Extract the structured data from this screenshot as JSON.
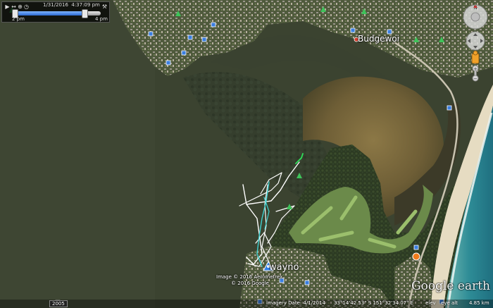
{
  "time_slider": {
    "date": "1/31/2016",
    "time": "4:37:09 pm",
    "start_label": "2 pm",
    "end_label": "4 pm",
    "position": 0.82
  },
  "places": {
    "budgewoi": "Budgewoi",
    "wayno": "wayno"
  },
  "credits": {
    "line1": "Image © 2016 Aerometrex",
    "line2": "© 2016 Google"
  },
  "status_bar": {
    "year": "2005",
    "imagery_date": "Imagery Date: 4/1/2014",
    "coordinates": "33°14'42.53\" S  151°32'34.07\" E",
    "elev_label": "elev",
    "eye_alt_label": "eye alt",
    "eye_alt_value": "4.85 km"
  },
  "logo": {
    "text": "Google earth"
  },
  "colors": {
    "lake_water": "#3d4531",
    "track_white": "#ffffff",
    "track_cyan": "#3fd0d0",
    "track_green": "#2ee25a",
    "pin_blue": "#2f7fe8",
    "poi_green": "#3ec45a",
    "poi_blue": "#3a7ee0"
  },
  "icons": {
    "play": "play-icon",
    "wrench": "wrench-icon",
    "nav_look": "look-around-icon",
    "nav_move": "move-icon",
    "zoom_in": "zoom-in-icon",
    "zoom_out": "zoom-out-icon",
    "pegman": "street-view-pegman-icon",
    "user_pin": "user-location-pin-icon"
  }
}
